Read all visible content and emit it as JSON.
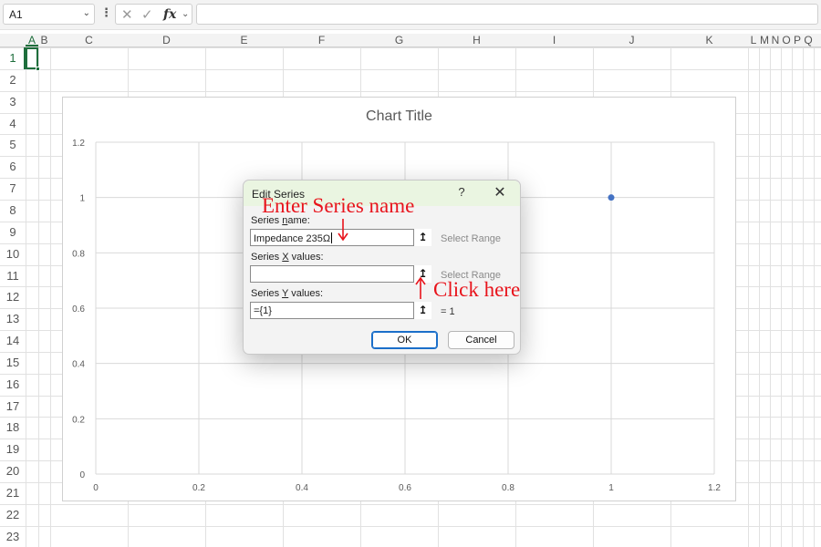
{
  "formula_bar": {
    "name_box": "A1",
    "cancel_icon": "x-icon",
    "enter_icon": "check-icon",
    "fx_label": "fx",
    "formula_value": ""
  },
  "columns": [
    "A",
    "B",
    "C",
    "D",
    "E",
    "F",
    "G",
    "H",
    "I",
    "J",
    "K",
    "L",
    "M",
    "N",
    "O",
    "P",
    "Q"
  ],
  "rows": [
    "1",
    "2",
    "3",
    "4",
    "5",
    "6",
    "7",
    "8",
    "9",
    "10",
    "11",
    "12",
    "13",
    "14",
    "15",
    "16",
    "17",
    "18",
    "19",
    "20",
    "21",
    "22",
    "23"
  ],
  "chart": {
    "title": "Chart Title"
  },
  "chart_data": {
    "type": "scatter",
    "title": "Chart Title",
    "xlabel": "",
    "ylabel": "",
    "xlim": [
      0,
      1.2
    ],
    "ylim": [
      0,
      1.2
    ],
    "x_ticks": [
      "0",
      "0.2",
      "0.4",
      "0.6",
      "0.8",
      "1",
      "1.2"
    ],
    "y_ticks": [
      "0",
      "0.2",
      "0.4",
      "0.6",
      "0.8",
      "1",
      "1.2"
    ],
    "grid": true,
    "series": [
      {
        "x": [
          1
        ],
        "y": [
          1
        ],
        "color": "#4472c4"
      }
    ]
  },
  "dialog": {
    "title": "Edit Series",
    "help": "?",
    "close_icon": "close-icon",
    "series_name": {
      "label_pre": "Series ",
      "label_u": "n",
      "label_post": "ame:",
      "value": "Impedance 235Ω",
      "note": "Select Range"
    },
    "series_x": {
      "label_pre": "Series ",
      "label_u": "X",
      "label_post": " values:",
      "value": "",
      "note": "Select Range"
    },
    "series_y": {
      "label_pre": "Series ",
      "label_u": "Y",
      "label_post": " values:",
      "value": "={1}",
      "note": "= 1"
    },
    "ok_label": "OK",
    "cancel_label": "Cancel"
  },
  "annotations": {
    "enter_series_name": "Enter Series name",
    "click_here": "Click here",
    "color": "#e8141c"
  }
}
